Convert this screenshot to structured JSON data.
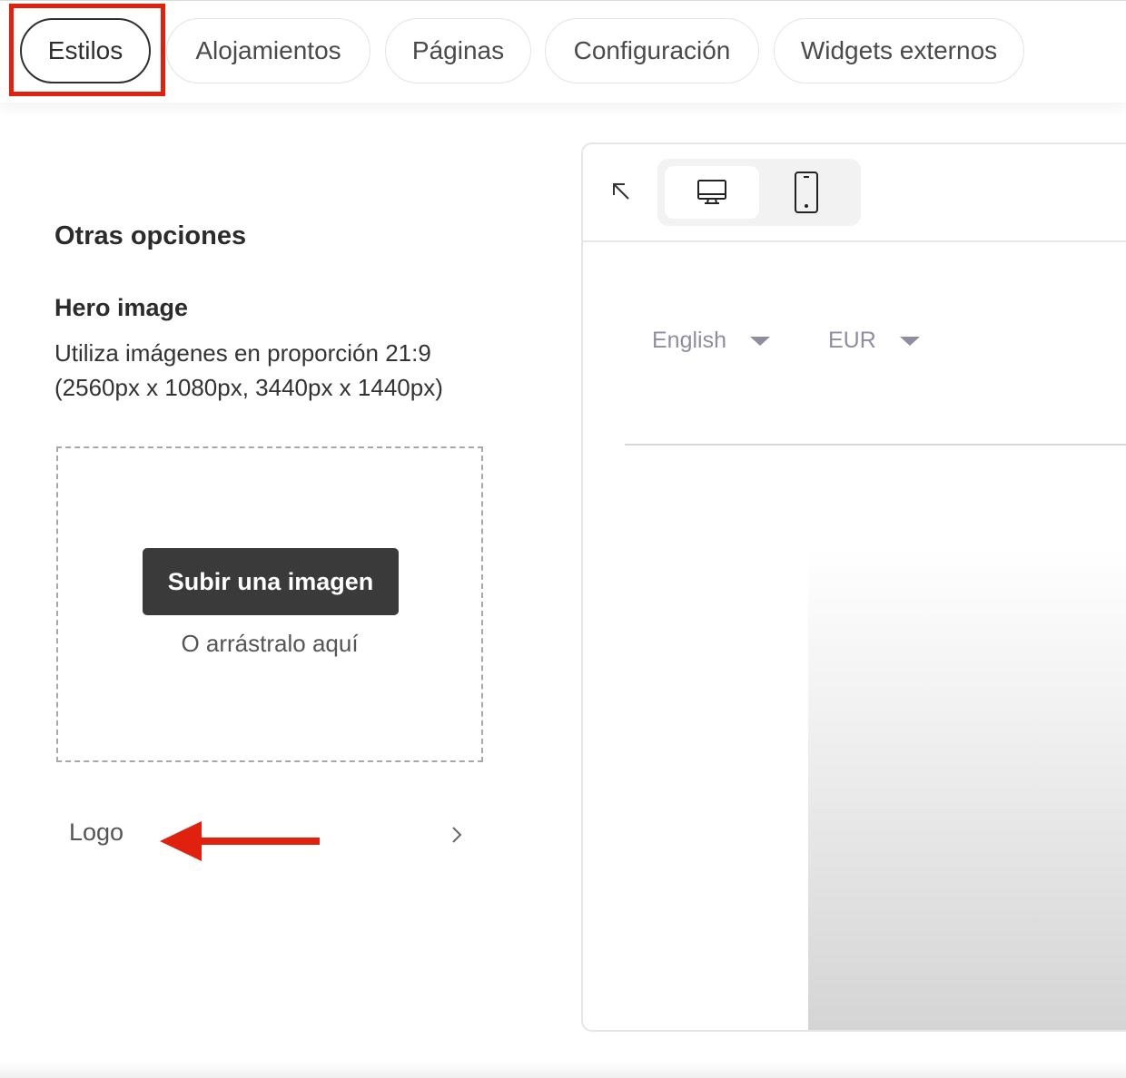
{
  "tabs": [
    {
      "label": "Estilos",
      "active": true
    },
    {
      "label": "Alojamientos",
      "active": false
    },
    {
      "label": "Páginas",
      "active": false
    },
    {
      "label": "Configuración",
      "active": false
    },
    {
      "label": "Widgets externos",
      "active": false
    }
  ],
  "left_panel": {
    "section_title": "Otras opciones",
    "hero": {
      "title": "Hero image",
      "description": "Utiliza imágenes en proporción 21:9 (2560px x 1080px, 3440px x 1440px)",
      "upload_button": "Subir una imagen",
      "drag_text": "O arrástralo aquí"
    },
    "logo_row": {
      "label": "Logo"
    }
  },
  "preview": {
    "device_options": [
      "desktop-icon",
      "mobile-icon"
    ],
    "selected_device": "desktop",
    "language": "English",
    "currency": "EUR"
  },
  "colors": {
    "highlight": "#e0210e",
    "primary_button": "#3a3a3a",
    "muted_text": "#8e8ea0"
  }
}
